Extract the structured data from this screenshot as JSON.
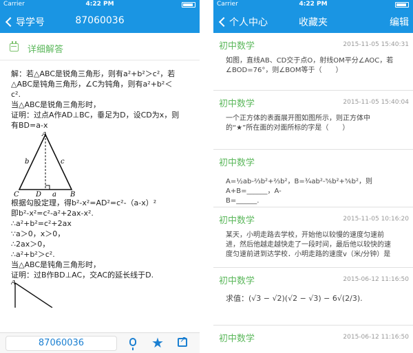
{
  "status_bar": {
    "carrier": "Carrier",
    "time": "4:22 PM"
  },
  "left_screen": {
    "nav": {
      "back_label": "导学号",
      "title": "87060036"
    },
    "answer_header": "详细解答",
    "solution_lines": [
      "解：若△ABC是锐角三角形，则有a²+b²＞c²，若",
      "△ABC是钝角三角形，∠C为钝角，则有a²+b²＜",
      "c².",
      "当△ABC是锐角三角形时，",
      "证明：过点A作AD⊥BC，垂足为D，设CD为x，则",
      "有BD=a-x"
    ],
    "triangle1_labels": {
      "top": "A",
      "left_side": "b",
      "right_side": "c",
      "bottom_left": "C",
      "foot": "D",
      "base": "a",
      "bottom_right": "B"
    },
    "solution_lines_2": [
      "根据勾股定理，得b²-x²=AD²=c²-（a-x）²",
      "即b²-x²=c²-a²+2ax-x².",
      "∴a²+b²=c²+2ax",
      "∵a＞0，x＞0，",
      "∴2ax＞0，",
      "∴a²+b²＞c².",
      "当△ABC是钝角三角形时，",
      "证明：过B作BD⊥AC，交AC的延长线于D."
    ],
    "triangle2_labels": {
      "top": "A"
    },
    "bottom_bar": {
      "id_value": "87060036"
    }
  },
  "right_screen": {
    "nav": {
      "back_label": "个人中心",
      "title": "收藏夹",
      "right_label": "编辑"
    },
    "items": [
      {
        "subject": "初中数学",
        "date": "2015-11-05 15:40:31",
        "lines": [
          "如图，直线AB、CD交于点O，射线OM平分∠AOC，若",
          "∠BOD=76°，则∠BOM等于（　　）"
        ]
      },
      {
        "subject": "初中数学",
        "date": "2015-11-05 15:40:04",
        "lines": [
          "一个正方体的表面展开图如图所示，则正方体中",
          "的“★”所在面的对面所标的字是（　　）"
        ]
      },
      {
        "subject": "初中数学",
        "date": "",
        "lines": [
          "A=½ab-⅔b²+⅔b²，B=¾ab²-⅚b²+⅚b²，则A+B=______，A-",
          "B=______."
        ]
      },
      {
        "subject": "初中数学",
        "date": "2015-11-05 10:16:20",
        "lines": [
          "某天，小明走路去学校，开始他以较慢的速度匀速前",
          "进，然后他越走越快走了一段时间，最后他以较快的速",
          "度匀速前进到达学校．小明走路的速度v（米/分钟）是"
        ]
      },
      {
        "subject": "初中数学",
        "date": "2015-06-12 11:16:50",
        "lines": [
          "求值：(√3 − √2)(√2 − √3) − 6√(2/3)."
        ]
      },
      {
        "subject": "初中数学",
        "date": "2015-06-12 11:16:50",
        "lines": []
      }
    ]
  }
}
